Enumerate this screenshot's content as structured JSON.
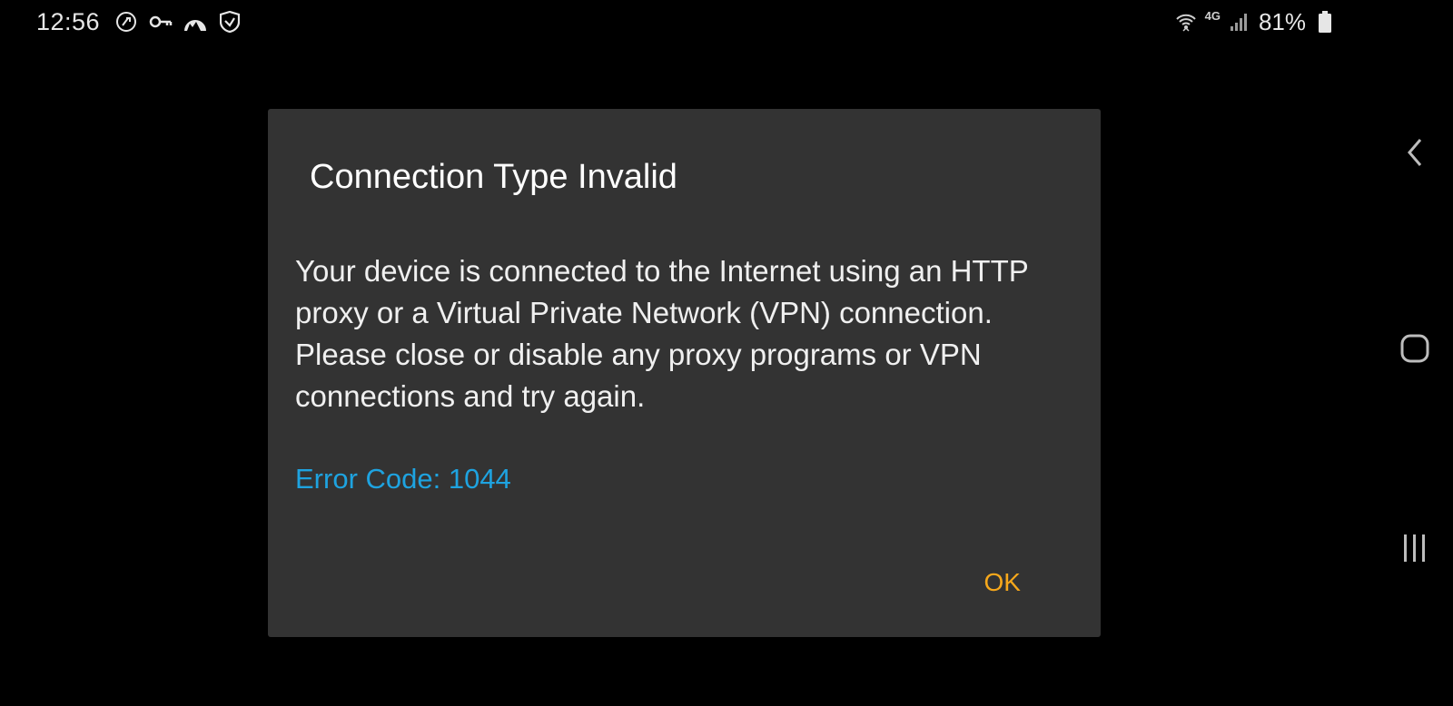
{
  "status_bar": {
    "time": "12:56",
    "left_icons": [
      "phone-call-icon",
      "key-icon",
      "vpn-mountain-icon",
      "shield-icon"
    ],
    "network_label": "4G",
    "battery_percent": "81%",
    "right_icons": [
      "wifi-icon",
      "lte-icon",
      "signal-icon",
      "battery-icon"
    ]
  },
  "dialog": {
    "title": "Connection Type Invalid",
    "message": "Your device is connected to the Internet using an HTTP proxy or a Virtual Private Network (VPN) connection. Please close or disable any proxy programs or VPN connections and try again.",
    "error_code": "Error Code: 1044",
    "ok_label": "OK"
  },
  "nav_bar": {
    "buttons": [
      "back-icon",
      "home-icon",
      "recents-icon"
    ]
  },
  "colors": {
    "background": "#000000",
    "dialog_bg": "#333333",
    "title": "#ffffff",
    "error": "#1ea3e0",
    "accent": "#f7a81b"
  }
}
